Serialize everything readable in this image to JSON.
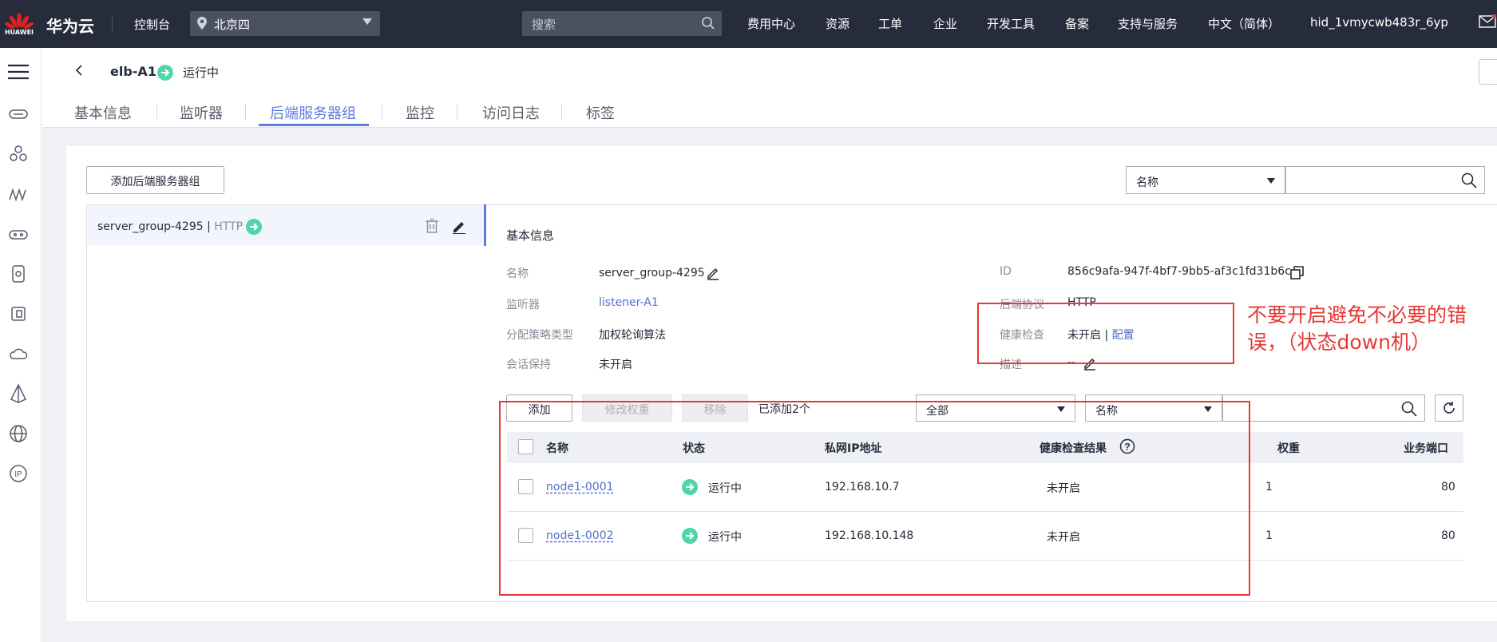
{
  "topbar": {
    "logo_text": "HUAWEI",
    "brand": "华为云",
    "console": "控制台",
    "region": "北京四",
    "search_placeholder": "搜索",
    "nav": [
      "费用中心",
      "资源",
      "工单",
      "企业",
      "开发工具",
      "备案",
      "支持与服务",
      "中文（简体）",
      "hid_1vmycwb483r_6yp"
    ]
  },
  "header": {
    "title": "elb-A1",
    "status": "运行中",
    "tabs": [
      "基本信息",
      "监听器",
      "后端服务器组",
      "监控",
      "访问日志",
      "标签"
    ],
    "active_tab": "后端服务器组"
  },
  "toolbar": {
    "add_group_button": "添加后端服务器组",
    "filter_select": "名称"
  },
  "group_list": {
    "name": "server_group-4295",
    "separator": " | ",
    "protocol": "HTTP"
  },
  "basic_info": {
    "title": "基本信息",
    "name_label": "名称",
    "name_value": "server_group-4295",
    "listener_label": "监听器",
    "listener_value": "listener-A1",
    "algo_label": "分配策略类型",
    "algo_value": "加权轮询算法",
    "session_label": "会话保持",
    "session_value": "未开启",
    "id_label": "ID",
    "id_value": "856c9afa-947f-4bf7-9bb5-af3c1fd31b6c",
    "protocol_label": "后端协议",
    "protocol_value": "HTTP",
    "health_label": "健康检查",
    "health_value": "未开启",
    "health_sep": "|",
    "health_config": "配置",
    "desc_label": "描述",
    "desc_value": "--"
  },
  "servers": {
    "add_button": "添加",
    "modify_weight_button": "修改权重",
    "remove_button": "移除",
    "added_count": "已添加2个",
    "scope_select": "全部",
    "filter_select": "名称",
    "columns": [
      "名称",
      "状态",
      "私网IP地址",
      "健康检查结果",
      "权重",
      "业务端口"
    ],
    "rows": [
      {
        "name": "node1-0001",
        "status": "运行中",
        "ip": "192.168.10.7",
        "health": "未开启",
        "weight": "1",
        "port": "80"
      },
      {
        "name": "node1-0002",
        "status": "运行中",
        "ip": "192.168.10.148",
        "health": "未开启",
        "weight": "1",
        "port": "80"
      }
    ]
  },
  "annotation": "不要开启避免不必要的错误，（状态down机）",
  "colors": {
    "accent": "#5e7ce0",
    "success": "#50d4ab",
    "annotation": "#e53935",
    "topbar": "#262c3b"
  }
}
